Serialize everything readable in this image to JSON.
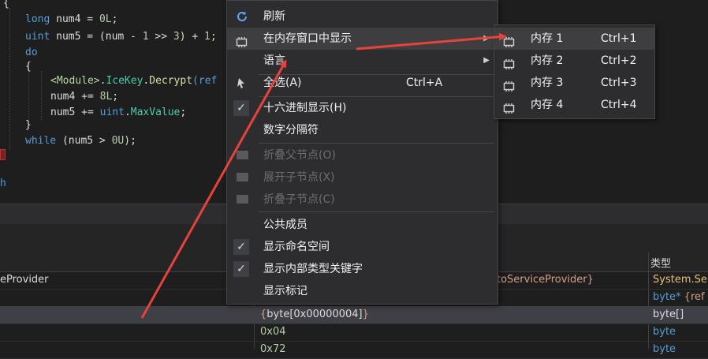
{
  "editor": {
    "lines": {
      "l0": "{",
      "l1_kw": "long",
      "l1_rest": " num4 = ",
      "l1_num": "0L",
      "l1_end": ";",
      "l2_kw": "uint",
      "l2_rest": " num5 = (num - ",
      "l2_n1": "1",
      "l2_mid": " >> ",
      "l2_n2": "3",
      "l2_mid2": ") + ",
      "l2_n3": "1",
      "l2_end": ";",
      "l3_kw": "do",
      "l4": "{",
      "l5_mod": "<Module>",
      "l5_dot": ".",
      "l5_ty": "IceKey",
      "l5_dot2": ".",
      "l5_fn": "Decrypt",
      "l5_rest": "(ref",
      "l6_a": "num4 += ",
      "l6_n": "8L",
      "l6_end": ";",
      "l7_a": "num5 += ",
      "l7_kw": "uint",
      "l7_dot": ".",
      "l7_ty": "MaxValue",
      "l7_end": ";",
      "l8": "}",
      "l9_kw": "while",
      "l9_a": " (num5 > ",
      "l9_n": "0U",
      "l9_end": ");",
      "l10": "h"
    }
  },
  "context_menu": {
    "items": [
      {
        "label": "刷新",
        "icon": "refresh-icon"
      },
      {
        "label": "在内存窗口中显示",
        "icon": "memory-chip-icon"
      },
      {
        "label": "语言"
      },
      {
        "label": "全选(A)",
        "shortcut": "Ctrl+A",
        "icon": "select-all-icon"
      },
      {
        "label": "十六进制显示(H)",
        "checked": true
      },
      {
        "label": "数字分隔符"
      },
      {
        "label": "折叠父节点(O)",
        "disabled": true
      },
      {
        "label": "展开子节点(X)",
        "disabled": true
      },
      {
        "label": "折叠子节点(C)",
        "disabled": true
      },
      {
        "label": "公共成员"
      },
      {
        "label": "显示命名空间",
        "checked": true
      },
      {
        "label": "显示内部类型关键字",
        "checked": true
      },
      {
        "label": "显示标记"
      }
    ]
  },
  "submenu": {
    "items": [
      {
        "label": "内存 1",
        "shortcut": "Ctrl+1"
      },
      {
        "label": "内存 2",
        "shortcut": "Ctrl+2"
      },
      {
        "label": "内存 3",
        "shortcut": "Ctrl+3"
      },
      {
        "label": "内存 4",
        "shortcut": "Ctrl+4"
      }
    ]
  },
  "grid": {
    "type_header": "类型",
    "rows": [
      {
        "name": "eProvider",
        "value": "toServiceProvider}",
        "type": "System.Se"
      },
      {
        "name": "",
        "value": "",
        "type_a": "byte* ",
        "type_b": "{ref"
      },
      {
        "name": "",
        "value_a": "{",
        "value_b": "byte[0x00000004]",
        "value_c": "}",
        "type": "byte[]"
      },
      {
        "name": "",
        "value": "0x04",
        "type": "byte"
      },
      {
        "name": "",
        "value": "0x72",
        "type": "byte"
      }
    ]
  },
  "colors": {
    "accent_arrow": "#e8423c",
    "keyword": "#569cd6",
    "type": "#4ec9b0",
    "string_value": "#d69d85",
    "type_column": "#e5c07b"
  }
}
